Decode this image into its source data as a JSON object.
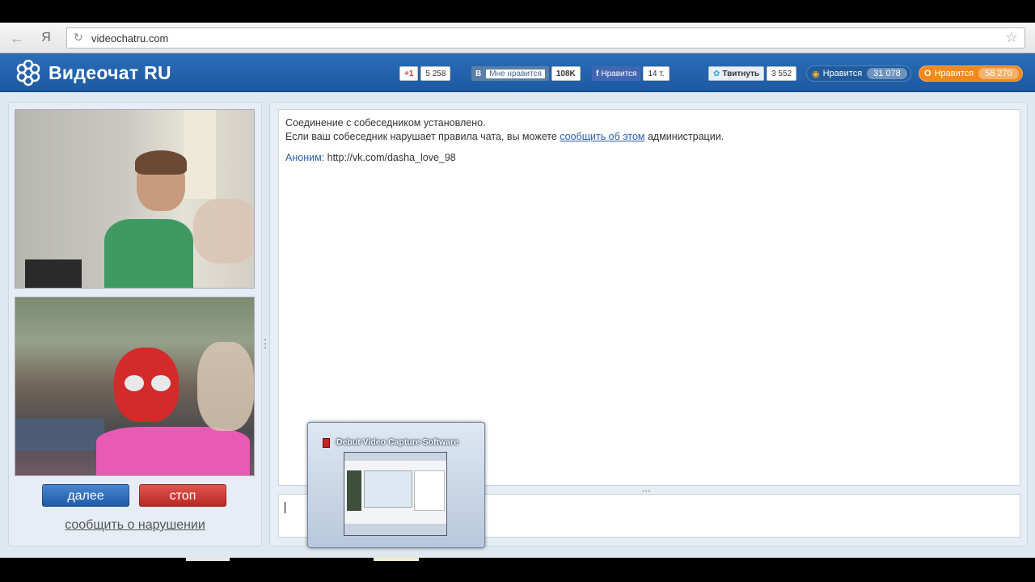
{
  "browser": {
    "back_icon": "back-arrow-icon",
    "yandex_label": "Я",
    "url": "videochatru.com"
  },
  "site": {
    "title": "Видеочат RU",
    "social": {
      "gplus": {
        "label": "+1",
        "count": "5 258"
      },
      "vk": {
        "label": "Мне нравится",
        "count": "108K"
      },
      "fb": {
        "label": "Нравится",
        "count": "14 т."
      },
      "twitter": {
        "label": "Твитнуть",
        "count": "3 552"
      },
      "mailru": {
        "label": "Нравится",
        "count": "31 078"
      },
      "ok": {
        "label": "Нравится",
        "count": "58 270"
      }
    }
  },
  "left": {
    "next_button": "далее",
    "stop_button": "стоп",
    "report_link": "сообщить о нарушении"
  },
  "chat": {
    "line1": "Соединение с собеседником установлено.",
    "line2_before": "Если ваш собеседник нарушает правила чата, вы можете ",
    "line2_link": "сообщить об этом",
    "line2_after": " администрации.",
    "message_author": "Аноним:",
    "message_text": " http://vk.com/dasha_love_98",
    "input_value": ""
  },
  "taskbar_preview": {
    "title": "Debut Video Capture Software"
  },
  "colors": {
    "header": "#1d5aa3",
    "next_button": "#1f5aa6",
    "stop_button": "#b92a25",
    "link": "#2a5ea8"
  }
}
